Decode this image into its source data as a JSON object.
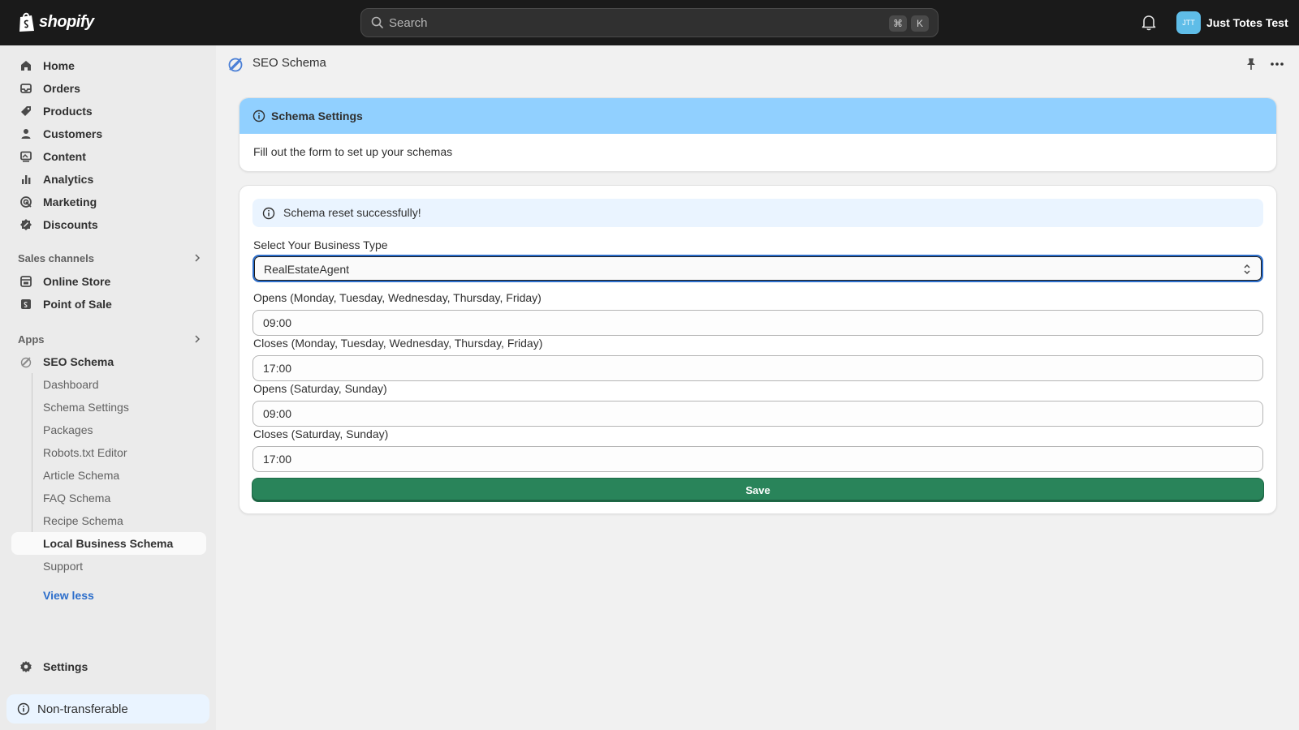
{
  "topbar": {
    "logo_text": "shopify",
    "search_placeholder": "Search",
    "shortcut_keys": [
      "⌘",
      "K"
    ],
    "account_initials": "JTT",
    "account_name": "Just Totes Test"
  },
  "sidebar": {
    "main_items": [
      {
        "label": "Home",
        "icon": "home-icon"
      },
      {
        "label": "Orders",
        "icon": "orders-icon"
      },
      {
        "label": "Products",
        "icon": "tag-icon"
      },
      {
        "label": "Customers",
        "icon": "person-icon"
      },
      {
        "label": "Content",
        "icon": "content-icon"
      },
      {
        "label": "Analytics",
        "icon": "bar-chart-icon"
      },
      {
        "label": "Marketing",
        "icon": "target-icon"
      },
      {
        "label": "Discounts",
        "icon": "discount-icon"
      }
    ],
    "sales_channels_label": "Sales channels",
    "sales_channels": [
      {
        "label": "Online Store",
        "icon": "store-icon"
      },
      {
        "label": "Point of Sale",
        "icon": "pos-icon"
      }
    ],
    "apps_label": "Apps",
    "app_name": "SEO Schema",
    "app_sub_items": [
      "Dashboard",
      "Schema Settings",
      "Packages",
      "Robots.txt Editor",
      "Article Schema",
      "FAQ Schema",
      "Recipe Schema",
      "Local Business Schema",
      "Support"
    ],
    "active_sub_item": "Local Business Schema",
    "view_less": "View less",
    "settings": "Settings",
    "non_transferable": "Non-transferable"
  },
  "main": {
    "page_title": "SEO Schema",
    "info_card": {
      "title": "Schema Settings",
      "body": "Fill out the form to set up your schemas"
    },
    "form": {
      "banner": "Schema reset successfully!",
      "business_type_label": "Select Your Business Type",
      "business_type_value": "RealEstateAgent",
      "fields": [
        {
          "label": "Opens (Monday, Tuesday, Wednesday, Thursday, Friday)",
          "value": "09:00"
        },
        {
          "label": "Closes (Monday, Tuesday, Wednesday, Thursday, Friday)",
          "value": "17:00"
        },
        {
          "label": "Opens (Saturday, Sunday)",
          "value": "09:00"
        },
        {
          "label": "Closes (Saturday, Sunday)",
          "value": "17:00"
        }
      ],
      "save_label": "Save"
    }
  },
  "colors": {
    "topbar": "#1a1a1a",
    "info_header": "#91d0ff",
    "save_button": "#29845a",
    "link": "#2c6ecb"
  }
}
